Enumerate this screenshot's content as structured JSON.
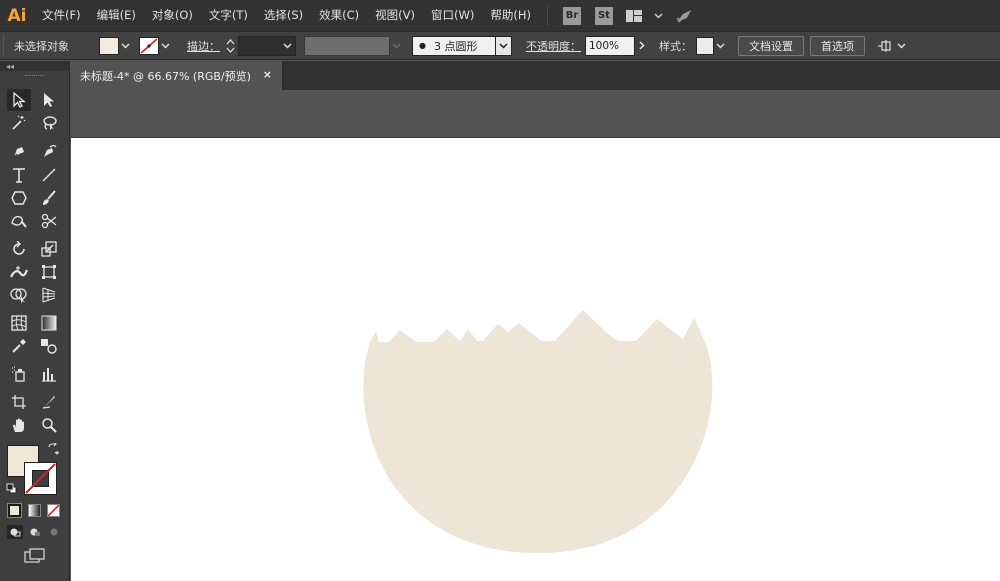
{
  "app": {
    "logo": "Ai",
    "accent": "#f3a43b"
  },
  "menu": {
    "items": [
      "文件(F)",
      "编辑(E)",
      "对象(O)",
      "文字(T)",
      "选择(S)",
      "效果(C)",
      "视图(V)",
      "窗口(W)",
      "帮助(H)"
    ],
    "badges": [
      "Br",
      "St"
    ],
    "icons": [
      "workspace-layout-icon",
      "chevron-down-icon",
      "gpu-rocket-icon"
    ]
  },
  "control": {
    "selection_label": "未选择对象",
    "fill_color": "#f2ede0",
    "stroke_color": "none",
    "stroke_label": "描边：",
    "stroke_value": "",
    "brush_label": "3 点圆形",
    "opacity_label": "不透明度：",
    "opacity_value": "100%",
    "style_label": "样式：",
    "doc_setup_button": "文档设置",
    "preferences_button": "首选项"
  },
  "document": {
    "tab_title": "未标题-4* @ 66.67% (RGB/预览)",
    "close_symbol": "×"
  },
  "toolbox": {
    "fill_color": "#efe9d8",
    "tools": [
      "selection-tool",
      "direct-selection-tool",
      "magic-wand-tool",
      "lasso-tool",
      "pen-tool",
      "curvature-tool",
      "type-tool",
      "line-segment-tool",
      "polygon-tool",
      "paintbrush-tool",
      "shaper-tool",
      "scissors-tool",
      "rotate-tool",
      "scale-tool",
      "width-tool",
      "free-transform-tool",
      "shape-builder-tool",
      "perspective-grid-tool",
      "mesh-tool",
      "gradient-tool",
      "eyedropper-tool",
      "blend-tool",
      "symbol-sprayer-tool",
      "column-graph-tool",
      "artboard-tool",
      "slice-tool",
      "hand-tool",
      "zoom-tool"
    ]
  },
  "artwork": {
    "shape": "broken-eggshell",
    "color": "#ede5d5"
  }
}
